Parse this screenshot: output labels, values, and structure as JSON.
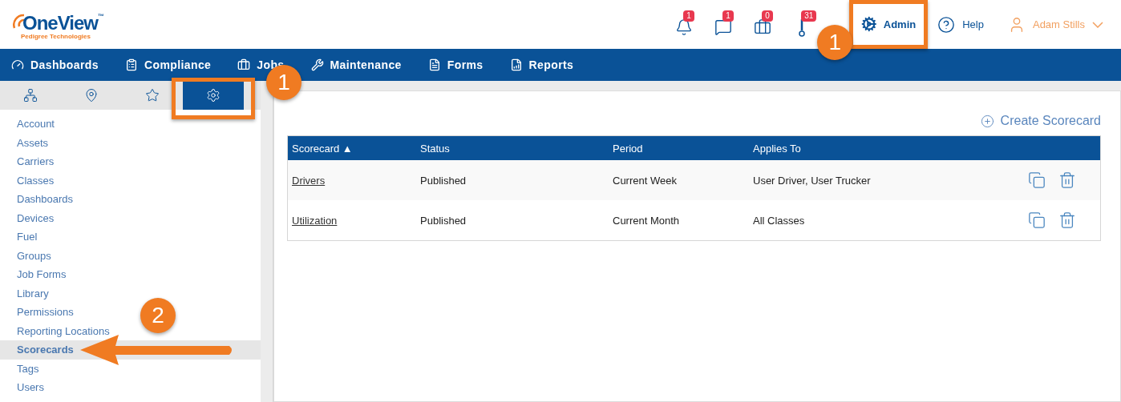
{
  "logo": {
    "name": "OneView",
    "tm": "™",
    "tagline": "Pedigree Technologies"
  },
  "header": {
    "alerts": [
      {
        "kind": "bell",
        "count": "1"
      },
      {
        "kind": "chat",
        "count": "1"
      },
      {
        "kind": "briefcase",
        "count": "0"
      },
      {
        "kind": "exclamation",
        "count": "31"
      }
    ],
    "admin": {
      "label": "Admin",
      "framed": true,
      "callout": "1"
    },
    "help": "Help",
    "user": "Adam Stills"
  },
  "nav": [
    {
      "kind": "gauge",
      "label": "Dashboards"
    },
    {
      "kind": "clipboard",
      "label": "Compliance"
    },
    {
      "kind": "briefcase",
      "label": "Jobs"
    },
    {
      "kind": "wrench",
      "label": "Maintenance"
    },
    {
      "kind": "form",
      "label": "Forms"
    },
    {
      "kind": "report",
      "label": "Reports"
    }
  ],
  "sidebar": {
    "tabs": [
      {
        "kind": "tree",
        "selected": false
      },
      {
        "kind": "pin",
        "selected": false
      },
      {
        "kind": "star",
        "selected": false
      },
      {
        "kind": "gears",
        "selected": true,
        "framed": true,
        "callout": "1"
      }
    ],
    "items": [
      {
        "label": "Account",
        "selected": false
      },
      {
        "label": "Assets",
        "selected": false
      },
      {
        "label": "Carriers",
        "selected": false
      },
      {
        "label": "Classes",
        "selected": false
      },
      {
        "label": "Dashboards",
        "selected": false
      },
      {
        "label": "Devices",
        "selected": false
      },
      {
        "label": "Fuel",
        "selected": false
      },
      {
        "label": "Groups",
        "selected": false
      },
      {
        "label": "Job Forms",
        "selected": false
      },
      {
        "label": "Library",
        "selected": false
      },
      {
        "label": "Permissions",
        "selected": false
      },
      {
        "label": "Reporting Locations",
        "selected": false
      },
      {
        "label": "Scorecards",
        "selected": true,
        "callout": "2"
      },
      {
        "label": "Tags",
        "selected": false
      },
      {
        "label": "Users",
        "selected": false
      }
    ]
  },
  "create_button": "Create Scorecard",
  "table": {
    "columns": [
      {
        "label": "Scorecard",
        "sort_mark": "▲"
      },
      {
        "label": "Status"
      },
      {
        "label": "Period"
      },
      {
        "label": "Applies To"
      }
    ],
    "rows": [
      {
        "name": "Drivers",
        "status": "Published",
        "period": "Current Week",
        "applies_to": "User Driver, User Trucker"
      },
      {
        "name": "Utilization",
        "status": "Published",
        "period": "Current Month",
        "applies_to": "All Classes"
      }
    ]
  }
}
